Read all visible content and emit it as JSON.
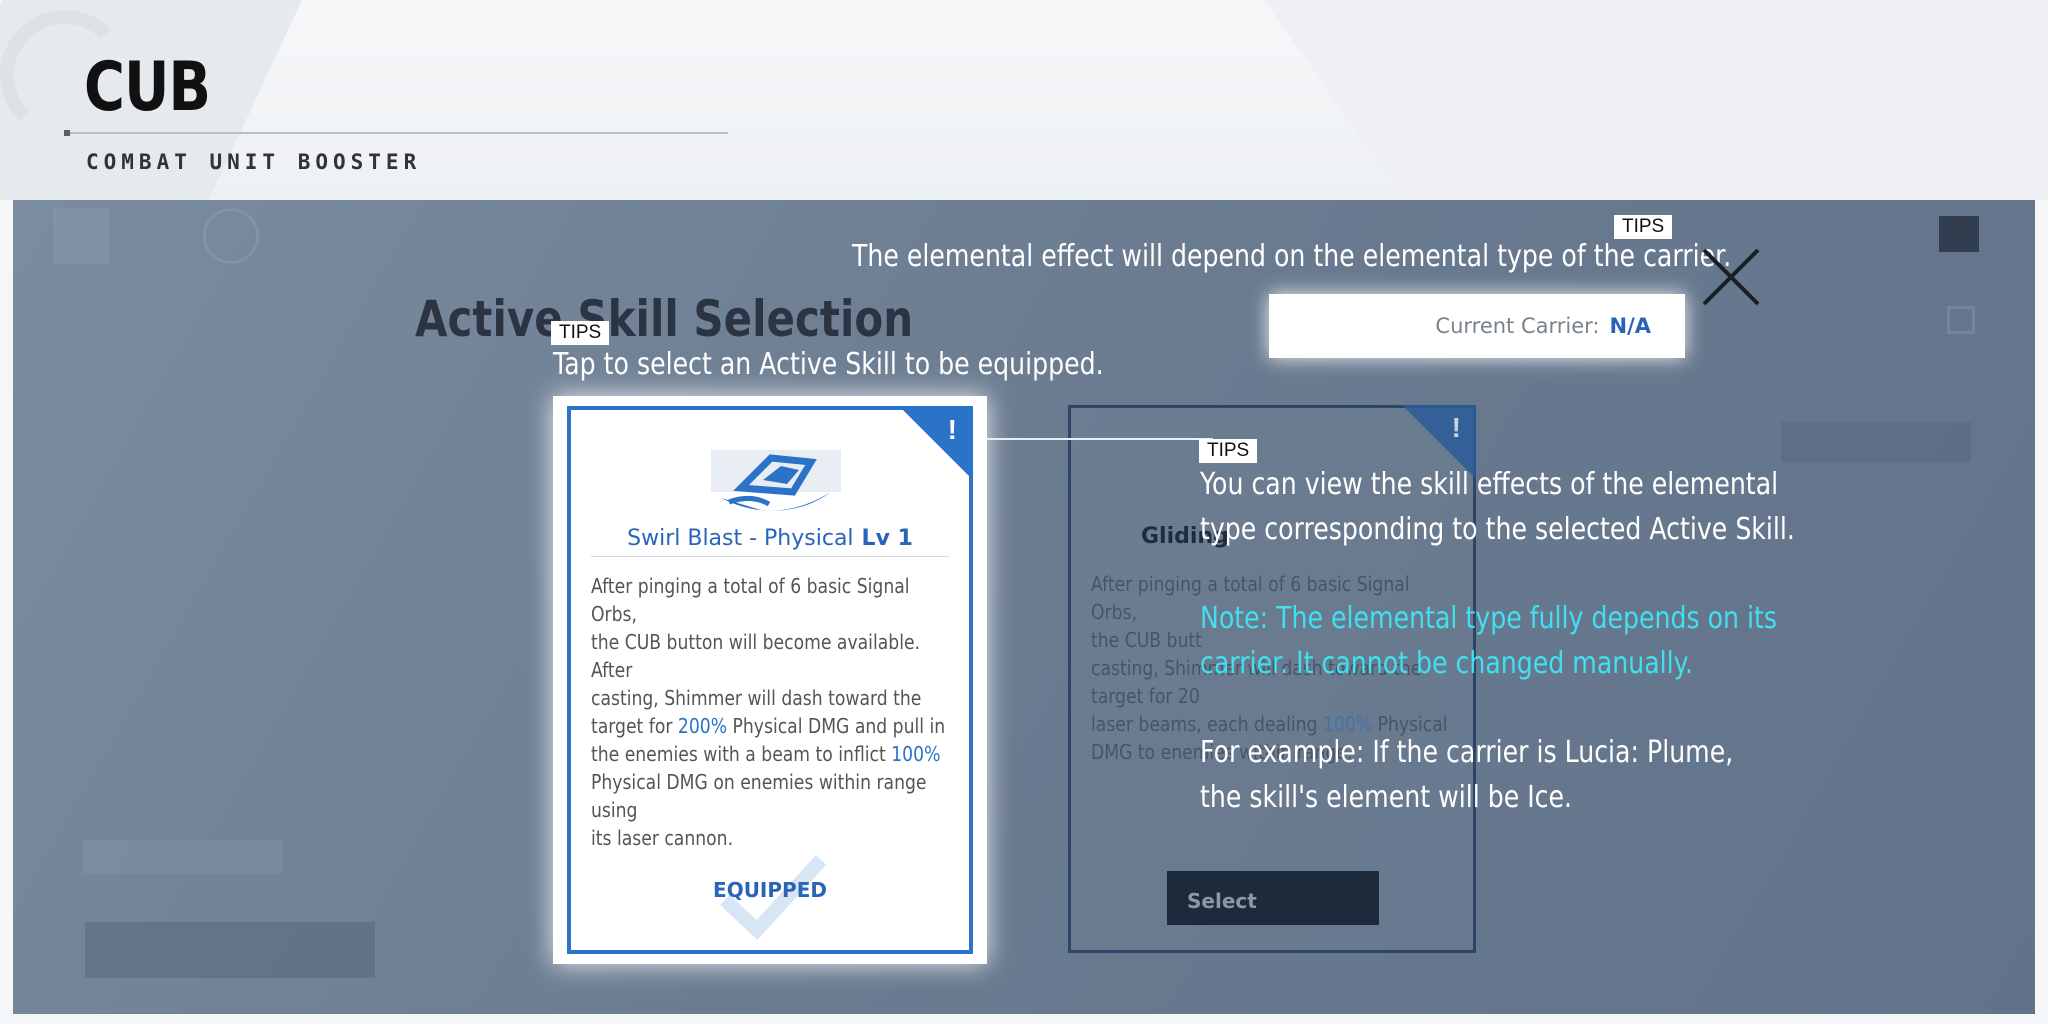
{
  "header": {
    "title": "CUB",
    "subtitle": "COMBAT UNIT BOOSTER"
  },
  "dialog": {
    "heading": "Active Skill Selection",
    "close_icon": "close-icon",
    "carrier_label": "Current Carrier:",
    "carrier_value": "N/A"
  },
  "tips": [
    {
      "label": "TIPS",
      "text": "The elemental effect will depend on the elemental type of the carrier."
    },
    {
      "label": "TIPS",
      "text": "Tap to select an Active Skill to be equipped."
    },
    {
      "label": "TIPS",
      "text_lines": [
        "You can view the skill effects of the elemental",
        "type corresponding to the selected Active Skill."
      ],
      "note_lines": [
        "Note: The elemental type fully depends on its",
        "carrier. It cannot be changed manually."
      ],
      "example_lines": [
        "For example: If the carrier is Lucia: Plume,",
        "the skill's element will be Ice."
      ]
    }
  ],
  "cards": [
    {
      "name": "Swirl Blast - Physical",
      "level": "Lv 1",
      "desc_parts": [
        "After pinging a total of 6 basic Signal Orbs,",
        "the CUB button will become available. After",
        "casting, Shimmer will dash toward the",
        "target for ",
        "200%",
        " Physical DMG and pull in",
        "the enemies with a beam to inflict ",
        "100%",
        "Physical DMG on enemies within range using",
        "its laser cannon."
      ],
      "status": "EQUIPPED",
      "icon": "swirl-blast-icon"
    },
    {
      "name": "Gliding",
      "desc_parts": [
        "After pinging a total of 6 basic Signal Orbs,",
        "the CUB butt",
        "casting, Shimmer will dash toward the",
        "target for 20",
        "laser beams, each dealing ",
        "100%",
        " Physical",
        "DMG to enemies within range."
      ],
      "button": "Select"
    }
  ],
  "colors": {
    "accent": "#2a73c8",
    "note": "#40e0f0",
    "overlay": "#6f8196"
  }
}
